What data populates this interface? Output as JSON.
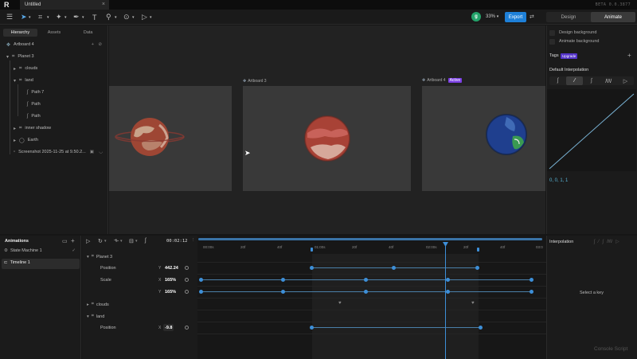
{
  "app": {
    "document_title": "Untitled",
    "logo_text": "R",
    "version": "BETA 0.0.3877"
  },
  "toolbar": {
    "avatar_initial": "g",
    "zoom": "33%",
    "export_label": "Export",
    "mode_tabs": [
      "Design",
      "Animate"
    ],
    "active_mode": "Animate"
  },
  "left_panel": {
    "tabs": [
      "Hierarchy",
      "Assets",
      "Data"
    ],
    "artboard": "Artboard 4",
    "tree": [
      {
        "label": "Planet 3",
        "icon": "group-icon"
      },
      {
        "label": "clouds",
        "icon": "group-icon"
      },
      {
        "label": "land",
        "icon": "group-icon"
      },
      {
        "label": "Path 7",
        "icon": "path-icon"
      },
      {
        "label": "Path",
        "icon": "path-icon"
      },
      {
        "label": "Path",
        "icon": "path-icon"
      },
      {
        "label": "inner shadow",
        "icon": "group-icon"
      },
      {
        "label": "Earth",
        "icon": "ellipse-icon"
      },
      {
        "label": "Screenshot 2025-11-25 at 9.50.2...",
        "icon": "image-icon"
      }
    ]
  },
  "canvas": {
    "artboards": [
      {
        "label": ""
      },
      {
        "label": "Artboard 3"
      },
      {
        "label": "Artboard 4",
        "badge": "Active"
      }
    ]
  },
  "right_panel": {
    "design_background": "Design background",
    "animate_background": "Animate background",
    "tags_label": "Tags",
    "upgrade_label": "Upgrade",
    "default_interpolation": "Default Interpolation",
    "curve_values": "0, 0, 1, 1",
    "colors": {
      "accent": "#3d8fd8",
      "curve": "#59b6d8",
      "badge": "#7b3fe4"
    }
  },
  "animations_panel": {
    "title": "Animations",
    "items": [
      "State Machine 1",
      "Timeline 1"
    ],
    "selected": "Timeline 1"
  },
  "timeline": {
    "time": "00:02:12",
    "ruler_labels": [
      "00:00s",
      "20f",
      "40f",
      "01:00s",
      "20f",
      "40f",
      "02:00s",
      "20f",
      "40f",
      "03:0"
    ],
    "rows": [
      {
        "label": "Planet 3",
        "type": "group"
      },
      {
        "label": "Position",
        "axis": "Y",
        "value": "442.24"
      },
      {
        "label": "Scale",
        "axis": "X",
        "value": "165%"
      },
      {
        "label": "",
        "axis": "Y",
        "value": "165%"
      },
      {
        "label": "clouds",
        "type": "group"
      },
      {
        "label": "land",
        "type": "group"
      },
      {
        "label": "Position",
        "axis": "X",
        "value": "-9.8"
      }
    ]
  },
  "interpolation_panel": {
    "title": "Interpolation",
    "empty_text": "Select a key",
    "footer": "Console Script"
  }
}
